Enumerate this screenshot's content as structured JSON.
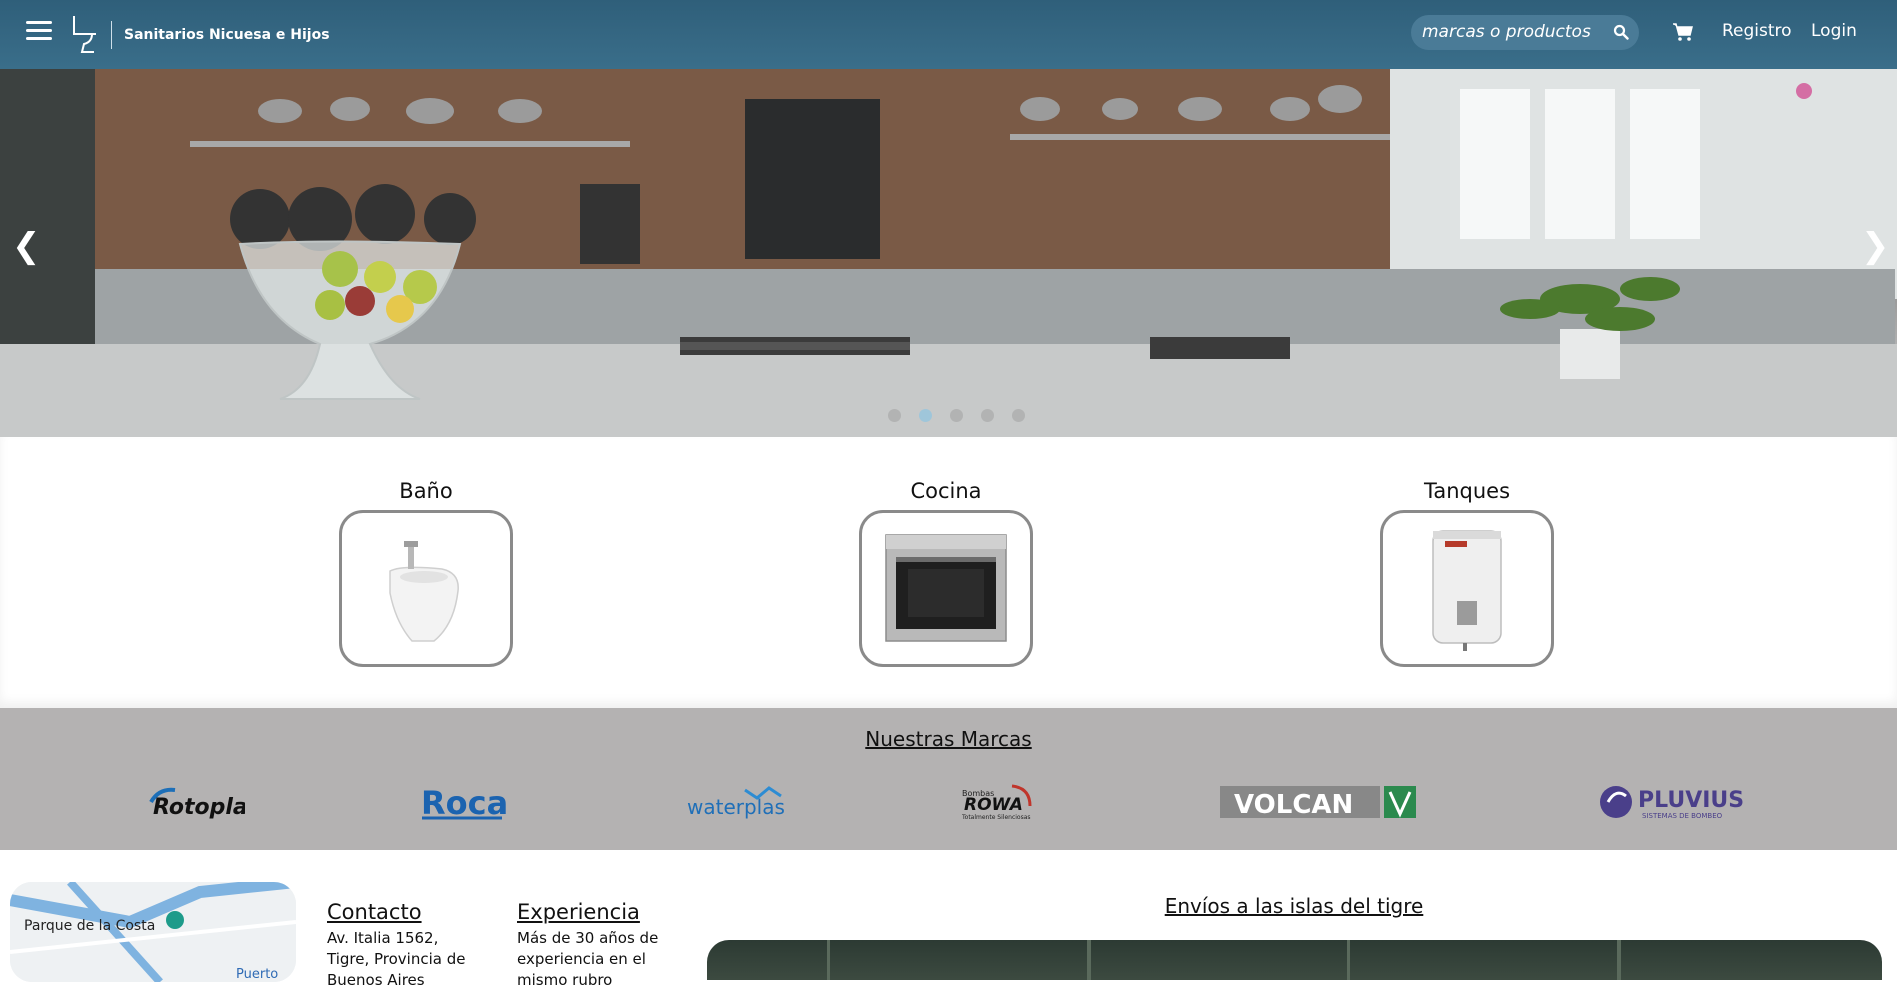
{
  "header": {
    "brand_name": "Sanitarios Nicuesa e Hijos",
    "search_placeholder": "marcas o productos",
    "register_label": "Registro",
    "login_label": "Login",
    "icons": [
      "menu-icon",
      "toilet-logo-icon",
      "search-icon",
      "cart-icon"
    ]
  },
  "carousel": {
    "prev_label": "❮",
    "next_label": "❯",
    "slide_count": 5,
    "active_slide": 2
  },
  "categories": [
    {
      "label": "Baño"
    },
    {
      "label": "Cocina"
    },
    {
      "label": "Tanques"
    }
  ],
  "brands": {
    "title": "Nuestras Marcas",
    "items": [
      {
        "name": "Rotoplas"
      },
      {
        "name": "Roca"
      },
      {
        "name": "waterplast"
      },
      {
        "name": "ROWA",
        "tag": "Bombas",
        "sub": "Totalmente Silenciosas"
      },
      {
        "name": "VOLCAN"
      },
      {
        "name": "PLUVIUS",
        "sub": "SISTEMAS DE BOMBEO"
      }
    ]
  },
  "footer": {
    "map_label": "Parque de la Costa",
    "map_label_2": "Puerto",
    "contact_title": "Contacto",
    "contact_text": "Av. Italia 1562, Tigre, Provincia de Buenos Aires",
    "experience_title": "Experiencia",
    "experience_text": "Más de 30 años de experiencia en el mismo rubro",
    "shipping_title": "Envíos a las islas del tigre"
  },
  "colors": {
    "header_bg": "#3a6e8a",
    "brands_bg": "#b4b2b2",
    "dot_active": "#9fc6da"
  }
}
